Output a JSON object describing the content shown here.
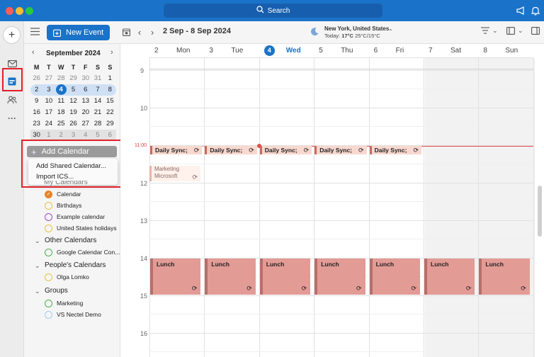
{
  "titlebar": {
    "search_label": "Search",
    "icon_names": [
      "search-icon",
      "megaphone-icon",
      "bell-icon"
    ]
  },
  "rail": {
    "items": [
      {
        "name": "compose",
        "icon": "plus-icon"
      },
      {
        "name": "mail",
        "icon": "mail-icon"
      },
      {
        "name": "calendar",
        "icon": "calendar-icon"
      },
      {
        "name": "people",
        "icon": "people-icon"
      },
      {
        "name": "more",
        "icon": "more-icon"
      }
    ]
  },
  "toolbar": {
    "new_event_label": "New Event",
    "date_range": "2 Sep - 8 Sep 2024",
    "weather_location": "New York, United States",
    "weather_today_label": "Today:",
    "weather_temp_now": "17°C",
    "weather_temp_range": "25°C/15°C"
  },
  "mini_calendar": {
    "title": "September 2024",
    "weekday_headers": [
      "M",
      "T",
      "W",
      "T",
      "F",
      "S",
      "S"
    ],
    "weeks": [
      [
        "26",
        "27",
        "28",
        "29",
        "30",
        "31",
        "1"
      ],
      [
        "2",
        "3",
        "4",
        "5",
        "6",
        "7",
        "8"
      ],
      [
        "9",
        "10",
        "11",
        "12",
        "13",
        "14",
        "15"
      ],
      [
        "16",
        "17",
        "18",
        "19",
        "20",
        "21",
        "22"
      ],
      [
        "23",
        "24",
        "25",
        "26",
        "27",
        "28",
        "29"
      ],
      [
        "30",
        "1",
        "2",
        "3",
        "4",
        "5",
        "6"
      ]
    ],
    "today": "4"
  },
  "sidebar": {
    "add_calendar_label": "Add Calendar",
    "popup_items": [
      "Add Shared Calendar...",
      "Import ICS..."
    ],
    "my_calendars_label": "My Calendars",
    "my_calendars": [
      {
        "label": "Calendar",
        "color": "#e8832a",
        "checked": true
      },
      {
        "label": "Birthdays",
        "color": "#e6c34a",
        "checked": false
      },
      {
        "label": "Example calendar",
        "color": "#9b4dca",
        "checked": false
      },
      {
        "label": "United States holidays",
        "color": "#e6c34a",
        "checked": false
      }
    ],
    "other_calendars_label": "Other Calendars",
    "other_calendars": [
      {
        "label": "Google Calendar Con...",
        "color": "#4caf50",
        "checked": false
      }
    ],
    "peoples_calendars_label": "People's Calendars",
    "peoples_calendars": [
      {
        "label": "Olga Lomko",
        "color": "#e6c34a",
        "checked": false
      }
    ],
    "groups_label": "Groups",
    "groups": [
      {
        "label": "Marketing",
        "color": "#4caf50",
        "checked": false
      },
      {
        "label": "VS Nectel Demo",
        "color": "#9fd0e8",
        "checked": false
      }
    ]
  },
  "week_view": {
    "days": [
      {
        "num": "2",
        "name": "Mon"
      },
      {
        "num": "3",
        "name": "Tue"
      },
      {
        "num": "4",
        "name": "Wed",
        "today": true
      },
      {
        "num": "5",
        "name": "Thu"
      },
      {
        "num": "6",
        "name": "Fri"
      },
      {
        "num": "7",
        "name": "Sat"
      },
      {
        "num": "8",
        "name": "Sun"
      }
    ],
    "hour_labels": [
      "9",
      "10",
      "12",
      "13",
      "14",
      "15",
      "16"
    ],
    "now_label": "11:00",
    "daily_sync_label": "Daily Sync;",
    "marketing_event": {
      "title": "Marketing",
      "subtitle": "Microsoft"
    },
    "lunch_label": "Lunch",
    "colors": {
      "accent": "#1a73c8",
      "now_line": "#e34c4c",
      "lunch": "#e39b96",
      "sync": "#f8d8cf"
    }
  }
}
